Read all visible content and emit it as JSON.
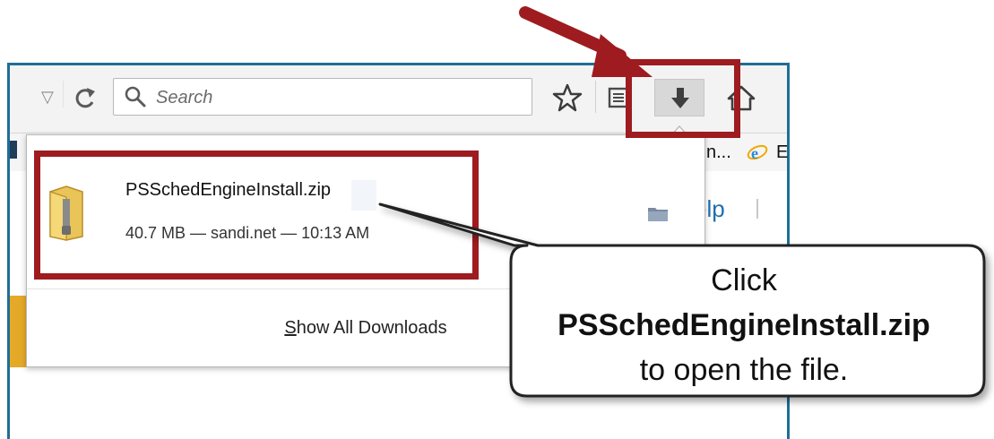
{
  "toolbar": {
    "search_placeholder": "Search"
  },
  "bookmarks_bar": {
    "item_text": "n...",
    "item2_text": "E"
  },
  "page": {
    "partial_link": "elp"
  },
  "downloads_panel": {
    "item": {
      "file_name": "PSSchedEngineInstall.zip",
      "meta": "40.7 MB — sandi.net — 10:13 AM"
    },
    "footer": {
      "accesskey": "S",
      "label_rest": "how All Downloads"
    }
  },
  "annotation": {
    "line1": "Click",
    "line2": "PSSchedEngineInstall.zip",
    "line3": "to open the file.",
    "color": "#9e1b20"
  },
  "icons": [
    "search-icon",
    "bookmark-star-icon",
    "reader-list-icon",
    "download-arrow-icon",
    "home-icon",
    "zip-file-icon",
    "folder-icon",
    "reload-icon",
    "dropmarker-icon"
  ]
}
